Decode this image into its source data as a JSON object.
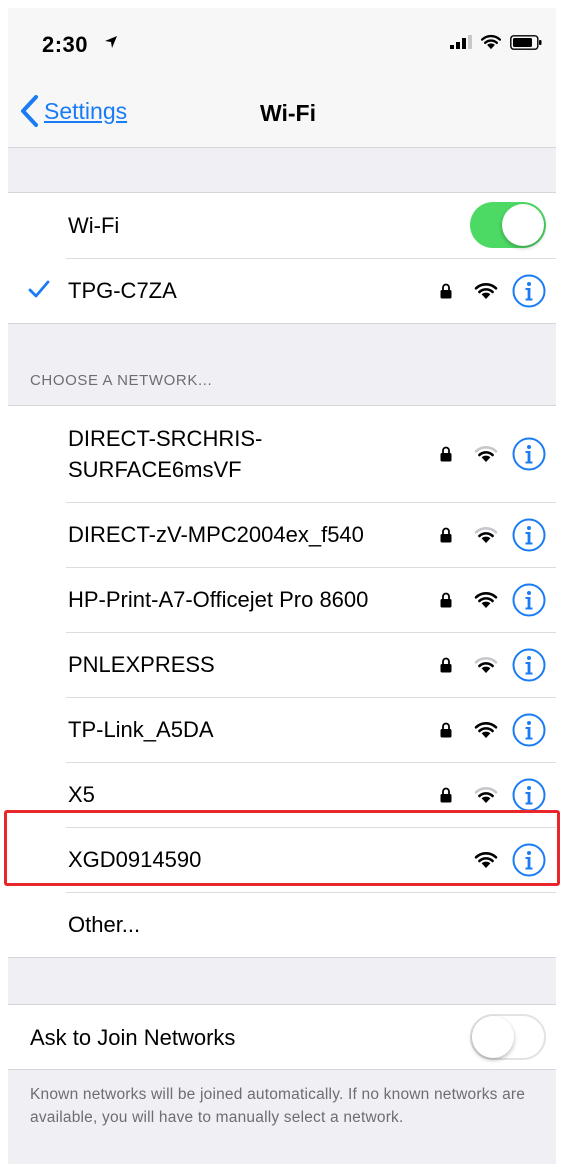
{
  "status_bar": {
    "time": "2:30"
  },
  "nav": {
    "back_label": "Settings",
    "title": "Wi-Fi"
  },
  "wifi_toggle": {
    "label": "Wi-Fi",
    "on": true
  },
  "connected_network": {
    "name": "TPG-C7ZA",
    "secured": true,
    "signal": "full"
  },
  "networks_section": {
    "header": "CHOOSE A NETWORK..."
  },
  "networks": [
    {
      "name_line1": "DIRECT-SRCHRIS-",
      "name_line2": "SURFACE6msVF",
      "secured": true,
      "signal": "medium"
    },
    {
      "name": "DIRECT-zV-MPC2004ex_f540",
      "secured": true,
      "signal": "medium"
    },
    {
      "name": "HP-Print-A7-Officejet Pro 8600",
      "secured": true,
      "signal": "full"
    },
    {
      "name": "PNLEXPRESS",
      "secured": true,
      "signal": "medium"
    },
    {
      "name": "TP-Link_A5DA",
      "secured": true,
      "signal": "full"
    },
    {
      "name": "X5",
      "secured": true,
      "signal": "medium"
    },
    {
      "name": "XGD0914590",
      "secured": false,
      "signal": "full",
      "highlighted": true
    },
    {
      "name": "Other...",
      "other": true
    }
  ],
  "ask_to_join": {
    "label": "Ask to Join Networks",
    "on": false,
    "footer": "Known networks will be joined automatically. If no known networks are available, you will have to manually select a network."
  },
  "colors": {
    "accent": "#1a7cf5",
    "toggle_on": "#4cd964",
    "highlight": "#e8262b",
    "background": "#efeff4"
  }
}
